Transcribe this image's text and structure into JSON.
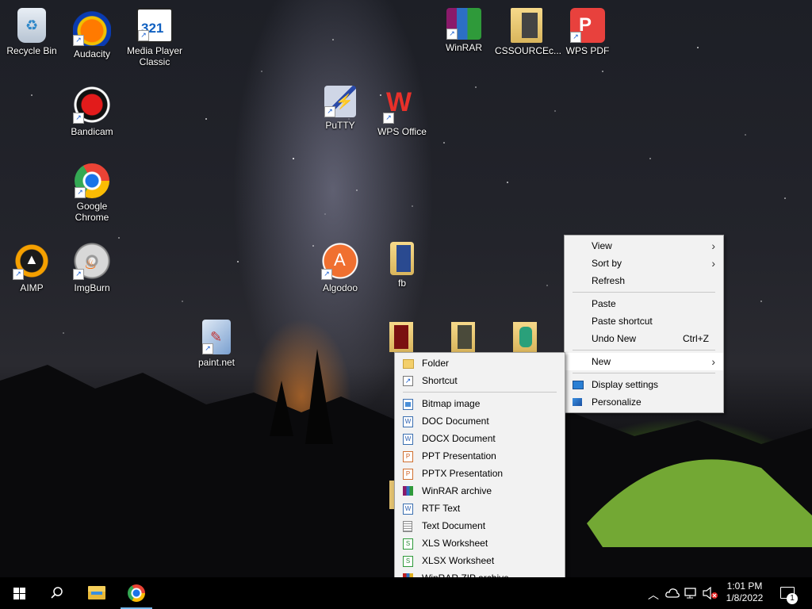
{
  "desktop": {
    "icons": [
      {
        "label": "Recycle Bin"
      },
      {
        "label": "Audacity"
      },
      {
        "label": "Media Player Classic"
      },
      {
        "label": "WinRAR"
      },
      {
        "label": "CSSOURCEc..."
      },
      {
        "label": "WPS PDF"
      },
      {
        "label": "Bandicam"
      },
      {
        "label": "PuTTY"
      },
      {
        "label": "WPS Office"
      },
      {
        "label": "Google Chrome"
      },
      {
        "label": "AIMP"
      },
      {
        "label": "ImgBurn"
      },
      {
        "label": "Algodoo"
      },
      {
        "label": "fb"
      },
      {
        "label": "paint.net"
      }
    ]
  },
  "context_menu": {
    "view": "View",
    "sort_by": "Sort by",
    "refresh": "Refresh",
    "paste": "Paste",
    "paste_shortcut": "Paste shortcut",
    "undo_new": "Undo New",
    "undo_new_accel": "Ctrl+Z",
    "new": "New",
    "display_settings": "Display settings",
    "personalize": "Personalize"
  },
  "new_submenu": {
    "items": [
      {
        "label": "Folder"
      },
      {
        "label": "Shortcut"
      },
      {
        "label": "Bitmap image"
      },
      {
        "label": "DOC Document"
      },
      {
        "label": "DOCX Document"
      },
      {
        "label": "PPT Presentation"
      },
      {
        "label": "PPTX Presentation"
      },
      {
        "label": "WinRAR archive"
      },
      {
        "label": "RTF Text"
      },
      {
        "label": "Text Document"
      },
      {
        "label": "XLS Worksheet"
      },
      {
        "label": "XLSX Worksheet"
      },
      {
        "label": "WinRAR ZIP archive"
      }
    ]
  },
  "taskbar": {
    "clock_time": "1:01 PM",
    "clock_date": "1/8/2022",
    "notification_count": "1"
  },
  "colors": {
    "taskbar": "#000000",
    "menu_bg": "#f2f2f2",
    "menu_highlight": "#ffffff"
  }
}
